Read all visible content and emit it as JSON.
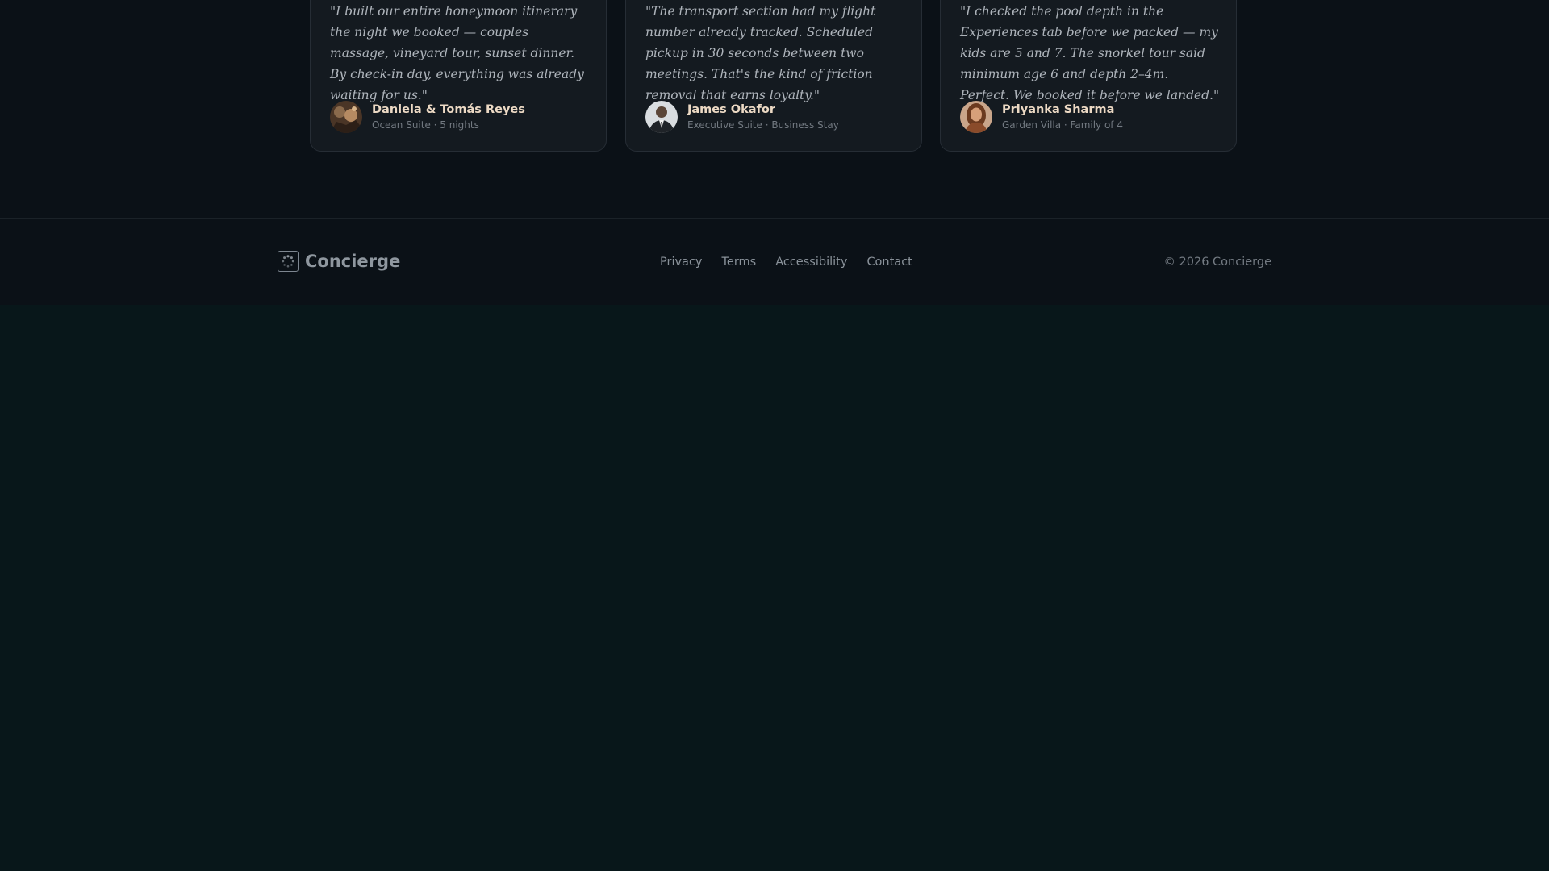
{
  "testimonials": [
    {
      "quote": "\"I built our entire honeymoon itinerary the night we booked — couples massage, vineyard tour, sunset dinner. By check-in day, everything was already waiting for us.\"",
      "name": "Daniela & Tomás Reyes",
      "meta": "Ocean Suite · 5 nights"
    },
    {
      "quote": "\"The transport section had my flight number already tracked. Scheduled pickup in 30 seconds between two meetings. That's the kind of friction removal that earns loyalty.\"",
      "name": "James Okafor",
      "meta": "Executive Suite · Business Stay"
    },
    {
      "quote": "\"I checked the pool depth in the Experiences tab before we packed — my kids are 5 and 7. The snorkel tour said minimum age 6 and depth 2–4m. Perfect. We booked it before we landed.\"",
      "name": "Priyanka Sharma",
      "meta": "Garden Villa · Family of 4"
    }
  ],
  "footer": {
    "brand": "Concierge",
    "links": [
      "Privacy",
      "Terms",
      "Accessibility",
      "Contact"
    ],
    "copyright": "© 2026 Concierge"
  },
  "colors": {
    "background": "#08171a",
    "surface": "#0b1117",
    "card": "#141a20",
    "author_name": "#ecd9c4"
  },
  "icons": {
    "brand_logo": "loading-ring-icon"
  }
}
